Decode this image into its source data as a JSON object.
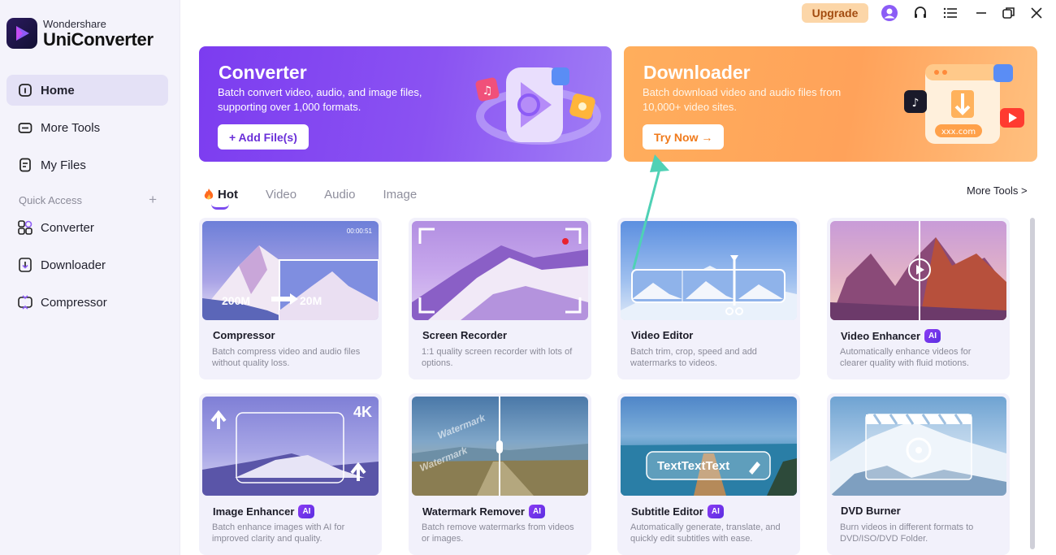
{
  "brand": {
    "vendor": "Wondershare",
    "product": "UniConverter"
  },
  "sidebar": {
    "items": [
      {
        "label": "Home",
        "icon": "home-icon",
        "active": true
      },
      {
        "label": "More Tools",
        "icon": "tools-icon"
      },
      {
        "label": "My Files",
        "icon": "files-icon"
      }
    ],
    "quick_access_label": "Quick Access",
    "quick_access_add": "+",
    "quick_items": [
      {
        "label": "Converter",
        "icon": "converter-icon"
      },
      {
        "label": "Downloader",
        "icon": "downloader-icon"
      },
      {
        "label": "Compressor",
        "icon": "compressor-icon"
      }
    ]
  },
  "titlebar": {
    "upgrade_label": "Upgrade",
    "icons": [
      "avatar-icon",
      "headset-icon",
      "menu-icon",
      "minimize-icon",
      "restore-icon",
      "close-icon"
    ]
  },
  "banners": {
    "converter": {
      "title": "Converter",
      "description": "Batch convert video, audio, and image files, supporting over 1,000 formats.",
      "button_label": "+ Add File(s)"
    },
    "downloader": {
      "title": "Downloader",
      "description": "Batch download video and audio files from 10,000+ video sites.",
      "button_label": "Try Now →"
    }
  },
  "tabs": [
    {
      "label": "Hot",
      "active": true
    },
    {
      "label": "Video"
    },
    {
      "label": "Audio"
    },
    {
      "label": "Image"
    }
  ],
  "more_tools_label": "More Tools >",
  "cards": [
    {
      "title": "Compressor",
      "ai": false,
      "description": "Batch compress video and audio files without quality loss.",
      "thumb": {
        "from": "200M",
        "to": "20M",
        "time": "00:00:51"
      }
    },
    {
      "title": "Screen Recorder",
      "ai": false,
      "description": "1:1 quality screen recorder with lots of options."
    },
    {
      "title": "Video Editor",
      "ai": false,
      "description": "Batch trim, crop, speed and add watermarks to videos."
    },
    {
      "title": "Video Enhancer",
      "ai": true,
      "ai_label": "AI",
      "description": "Automatically enhance videos for clearer quality with fluid motions."
    },
    {
      "title": "Image Enhancer",
      "ai": true,
      "ai_label": "AI",
      "description": "Batch enhance images with AI for improved clarity and quality.",
      "thumb": {
        "badge": "4K"
      }
    },
    {
      "title": "Watermark Remover",
      "ai": true,
      "ai_label": "AI",
      "description": "Batch remove watermarks from videos or images.",
      "thumb": {
        "watermark": "Watermark"
      }
    },
    {
      "title": "Subtitle Editor",
      "ai": true,
      "ai_label": "AI",
      "description": "Automatically generate, translate, and quickly edit subtitles with ease.",
      "thumb": {
        "caption": "TextTextText"
      }
    },
    {
      "title": "DVD Burner",
      "ai": false,
      "description": "Burn videos in different formats to DVD/ISO/DVD Folder."
    }
  ],
  "colors": {
    "accent": "#7b4bef",
    "annotation_arrow": "#4fd1b5",
    "converter_banner": "#7c3cf0",
    "downloader_banner": "#ffa25a"
  }
}
